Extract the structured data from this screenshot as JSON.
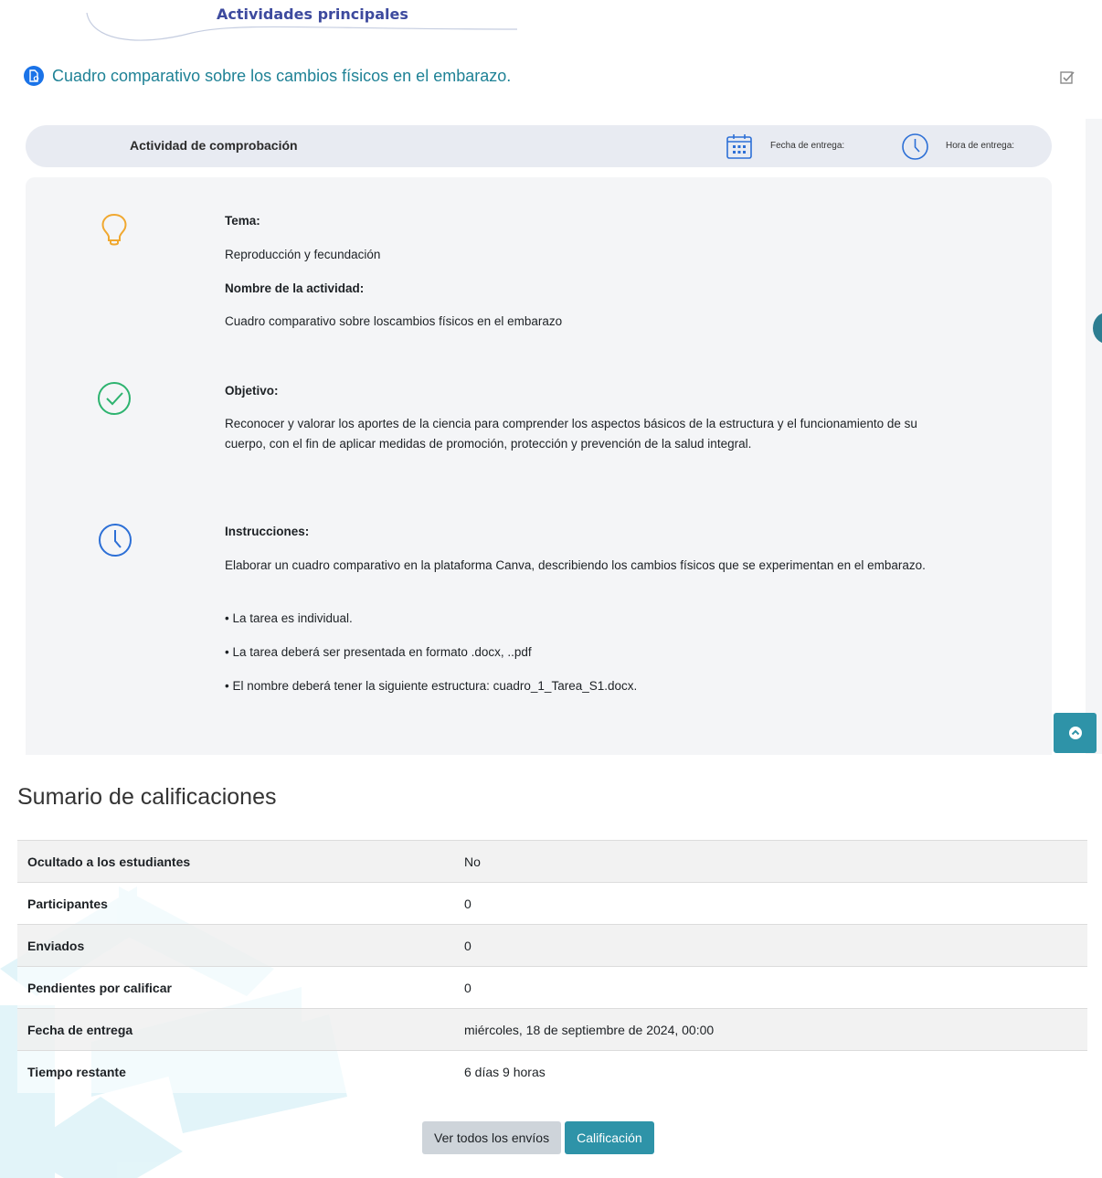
{
  "section": {
    "title": "Actividades principales"
  },
  "activity": {
    "name": "Cuadro comparativo sobre los cambios físicos en el embarazo.",
    "icon": "assignment-icon"
  },
  "info_bar": {
    "label": "Actividad de comprobación",
    "due_date_label": "Fecha de entrega:",
    "due_time_label": "Hora de entrega:"
  },
  "details": {
    "topic_label": "Tema:",
    "topic_value": "Reproducción y fecundación",
    "name_label": "Nombre de la actividad:",
    "name_value": "Cuadro comparativo sobre loscambios físicos en el embarazo",
    "objective_label": "Objetivo:",
    "objective_value": "Reconocer y valorar los aportes de la ciencia para comprender los aspectos básicos de la estructura y el funcionamiento de su cuerpo, con el fin de aplicar medidas de promoción, protección y prevención de la salud integral.",
    "instructions_label": "Instrucciones:",
    "instructions_value": "Elaborar un cuadro comparativo en la plataforma Canva, describiendo los cambios físicos que se experimentan en el embarazo.",
    "bullets": [
      "• La tarea es individual.",
      "• La tarea deberá ser presentada en formato .docx, ..pdf",
      "• El nombre deberá tener la siguiente estructura: cuadro_1_Tarea_S1.docx."
    ]
  },
  "summary": {
    "title": "Sumario de calificaciones",
    "rows": [
      {
        "label": "Ocultado a los estudiantes",
        "value": "No"
      },
      {
        "label": "Participantes",
        "value": "0"
      },
      {
        "label": "Enviados",
        "value": "0"
      },
      {
        "label": "Pendientes por calificar",
        "value": "0"
      },
      {
        "label": "Fecha de entrega",
        "value": "miércoles, 18 de septiembre de 2024, 00:00"
      },
      {
        "label": "Tiempo restante",
        "value": "6 días 9 horas"
      }
    ]
  },
  "buttons": {
    "view_all": "Ver todos los envíos",
    "grade": "Calificación"
  },
  "colors": {
    "accent": "#2e93a8",
    "link": "#1f8296",
    "title": "#3d4a9e"
  }
}
